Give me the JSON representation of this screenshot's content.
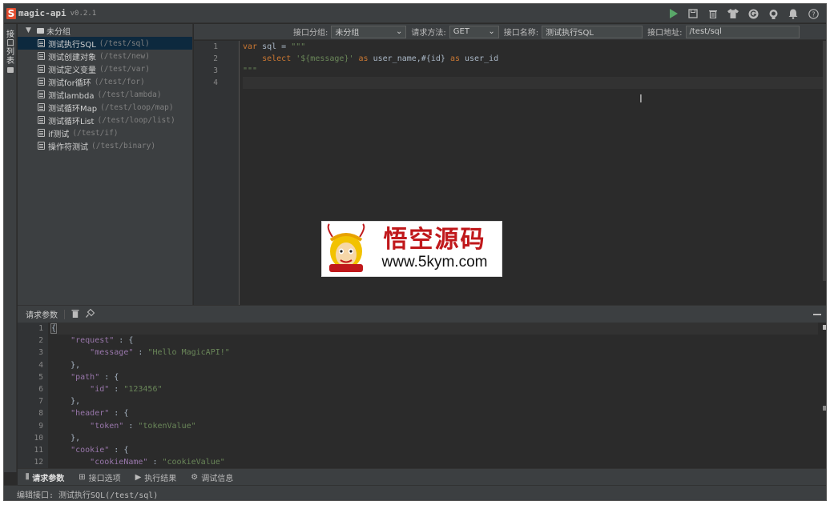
{
  "app": {
    "logo_letter": "S",
    "title": "magic-api",
    "version": "v0.2.1",
    "title_icons": [
      "play-icon",
      "save-icon",
      "delete-icon",
      "shirt-icon",
      "github-g-icon",
      "github-icon",
      "notification-icon",
      "help-icon"
    ]
  },
  "left_strip": {
    "tab_chars": [
      "接",
      "口",
      "列",
      "表"
    ]
  },
  "tree": {
    "group_label": "未分组",
    "items": [
      {
        "name": "测试执行SQL",
        "path": "(/test/sql)",
        "selected": true
      },
      {
        "name": "测试创建对象",
        "path": "(/test/new)"
      },
      {
        "name": "测试定义变量",
        "path": "(/test/var)"
      },
      {
        "name": "测试for循环",
        "path": "(/test/for)"
      },
      {
        "name": "测试lambda",
        "path": "(/test/lambda)"
      },
      {
        "name": "测试循环Map",
        "path": "(/test/loop/map)"
      },
      {
        "name": "测试循环List",
        "path": "(/test/loop/list)"
      },
      {
        "name": "if测试",
        "path": "(/test/if)"
      },
      {
        "name": "操作符测试",
        "path": "(/test/binary)"
      }
    ]
  },
  "toolbar": {
    "group_label": "接口分组:",
    "group_value": "未分组",
    "method_label": "请求方法:",
    "method_value": "GET",
    "name_label": "接口名称:",
    "name_value": "测试执行SQL",
    "url_label": "接口地址:",
    "url_value": "/test/sql"
  },
  "code_editor": {
    "line_numbers": [
      "1",
      "2",
      "3",
      "4"
    ],
    "line1_kw": "var",
    "line1_rest": " sql = ",
    "line1_str": "\"\"\"",
    "line2_indent": "    ",
    "line2_kw": "select",
    "line2_a": " ",
    "line2_str": "'${message}'",
    "line2_b": " ",
    "line2_kw2": "as",
    "line2_c": " user_name,#{id} ",
    "line2_kw3": "as",
    "line2_d": " user_id",
    "line3_str": "\"\"\""
  },
  "watermark": {
    "chinese": "悟空源码",
    "url": "www.5kym.com"
  },
  "params_panel": {
    "title": "请求参数",
    "line_numbers": [
      "1",
      "2",
      "3",
      "4",
      "5",
      "6",
      "7",
      "8",
      "9",
      "10",
      "11",
      "12"
    ],
    "json": {
      "l1": "{",
      "l2_key": "\"request\"",
      "l2_rest": " : {",
      "l3_key": "\"message\"",
      "l3_sep": " : ",
      "l3_val": "\"Hello MagicAPI!\"",
      "l4": "},",
      "l5_key": "\"path\"",
      "l5_rest": " : {",
      "l6_key": "\"id\"",
      "l6_sep": " : ",
      "l6_val": "\"123456\"",
      "l7": "},",
      "l8_key": "\"header\"",
      "l8_rest": " : {",
      "l9_key": "\"token\"",
      "l9_sep": " : ",
      "l9_val": "\"tokenValue\"",
      "l10": "},",
      "l11_key": "\"cookie\"",
      "l11_rest": " : {",
      "l12_key": "\"cookieName\"",
      "l12_sep": " : ",
      "l12_val": "\"cookieValue\""
    }
  },
  "bottom_tabs": [
    {
      "label": "请求参数",
      "icon": "sliders-icon",
      "active": true
    },
    {
      "label": "接口选项",
      "icon": "grid-icon"
    },
    {
      "label": "执行结果",
      "icon": "play-icon"
    },
    {
      "label": "调试信息",
      "icon": "bug-icon"
    }
  ],
  "status": {
    "text": "编辑接口: 测试执行SQL(/test/sql)"
  },
  "colors": {
    "background": "#2b2b2b",
    "panel": "#3c3f41",
    "selected": "#0d293e",
    "keyword": "#cc7832",
    "string": "#6a8759",
    "json_key": "#9876aa",
    "run_green": "#59a869",
    "logo_red": "#e04c2f"
  }
}
